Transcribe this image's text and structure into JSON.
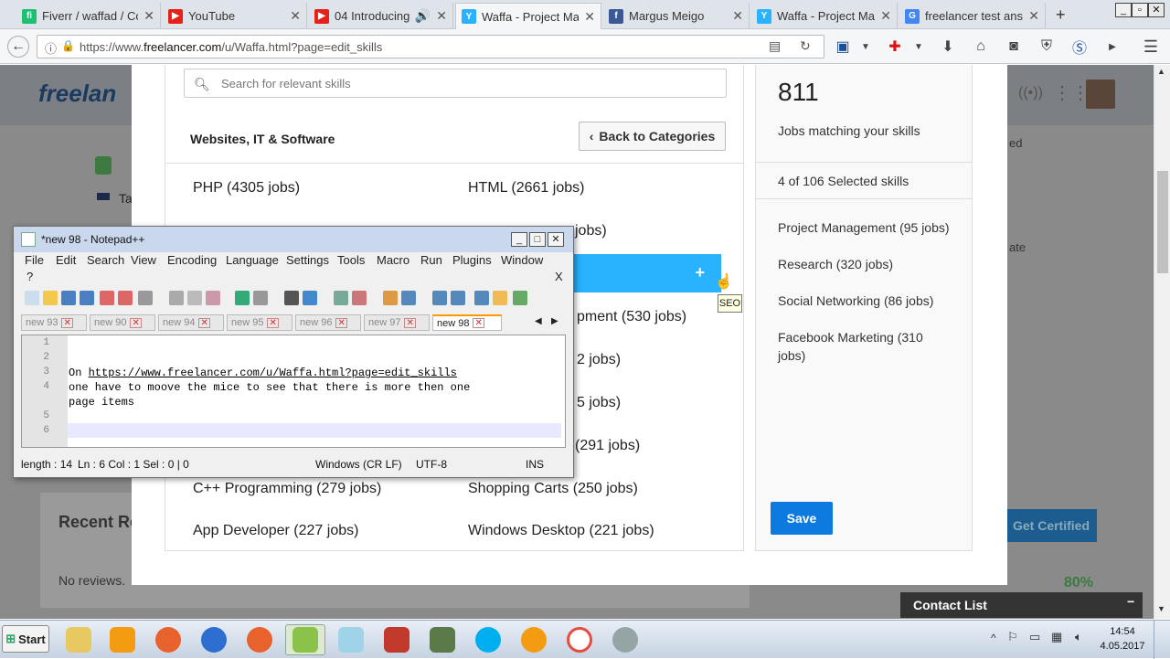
{
  "browser": {
    "tabs": [
      {
        "title": "Fiverr / waffad / Co",
        "icon": "fiverr-icon",
        "color": "#1dbf73",
        "glyph": "fi"
      },
      {
        "title": "YouTube",
        "icon": "youtube-icon",
        "color": "#e62117",
        "glyph": "▶"
      },
      {
        "title": "04 Introducing",
        "icon": "youtube-icon",
        "color": "#e62117",
        "glyph": "▶"
      },
      {
        "title": "Waffa - Project Man",
        "icon": "freelancer-icon",
        "color": "#29b2fe",
        "glyph": "Y"
      },
      {
        "title": "Margus Meigo",
        "icon": "facebook-icon",
        "color": "#3b5998",
        "glyph": "f"
      },
      {
        "title": "Waffa - Project Man",
        "icon": "freelancer-icon",
        "color": "#29b2fe",
        "glyph": "Y"
      },
      {
        "title": "freelancer test answ",
        "icon": "google-icon",
        "color": "#4285f4",
        "glyph": "G"
      }
    ],
    "url_prefix": "https://www.",
    "url_domain": "freelancer.com",
    "url_rest": "/u/Waffa.html?page=edit_skills"
  },
  "modal": {
    "search_placeholder": "Search for relevant skills",
    "category_title": "Websites, IT & Software",
    "back_button": "Back to Categories",
    "skills": [
      "PHP (4305 jobs)",
      "HTML (2661 jobs)",
      "jobs)",
      "pment (530 jobs)",
      "2 jobs)",
      "5 jobs)",
      "(291 jobs)",
      "C++ Programming (279 jobs)",
      "Shopping Carts (250 jobs)",
      "App Developer (227 jobs)",
      "Windows Desktop (221 jobs)"
    ],
    "highlight_plus": "+",
    "tooltip": "SEO"
  },
  "summary": {
    "jobs_count": "811",
    "jobs_label": "Jobs matching your skills",
    "selected_label": "4 of 106 Selected skills",
    "selected_skills": [
      "Project Management (95 jobs)",
      "Research (320 jobs)",
      "Social Networking (86 jobs)",
      "Facebook Marketing (310 jobs)"
    ],
    "save_button": "Save"
  },
  "background": {
    "logo": "freelan",
    "recent": "Recent Re",
    "no_reviews": "No reviews.",
    "get_certified": "Get Certified",
    "percent": "80%",
    "side1": "ed",
    "side2": "ate",
    "ta": "Ta"
  },
  "notepad": {
    "title": "*new 98 - Notepad++",
    "menu": [
      "File",
      "Edit",
      "Search",
      "View",
      "Encoding",
      "Language",
      "Settings",
      "Tools",
      "Macro",
      "Run",
      "Plugins",
      "Window",
      "?"
    ],
    "menu_close": "X",
    "tabs": [
      "new 93",
      "new 90",
      "new 94",
      "new 95",
      "new 96",
      "new 97",
      "new 98"
    ],
    "line_numbers": [
      "1",
      "2",
      "3",
      "4",
      "",
      "5",
      "6"
    ],
    "line3_prefix": "On ",
    "line3_link": "https://www.freelancer.com/u/Waffa.html?page=edit_skills",
    "line4": "one have to moove the mice to see that there is more then one",
    "line4b": "page items",
    "status": {
      "length": "length : 14",
      "pos": "Ln : 6    Col : 1    Sel : 0 | 0",
      "eol": "Windows (CR LF)",
      "enc": "UTF-8",
      "mode": "INS"
    }
  },
  "contact_list": "Contact List",
  "taskbar": {
    "start": "Start",
    "time": "14:54",
    "date": "4.05.2017"
  }
}
